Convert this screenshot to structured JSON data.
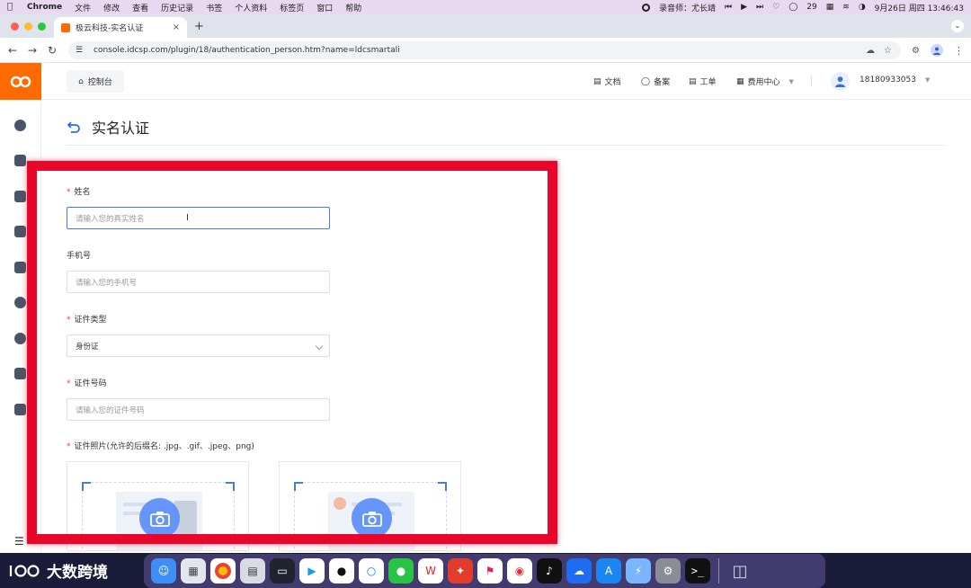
{
  "menubar": {
    "app": "Chrome",
    "items": [
      "文件",
      "修改",
      "查看",
      "历史记录",
      "书签",
      "个人资料",
      "标签页",
      "窗口",
      "帮助"
    ],
    "recorder": "录音师：尤长靖",
    "battery_count": "29",
    "datetime": "9月26日 周四 13:46:43"
  },
  "browser": {
    "tab_title": "极云科技-实名认证",
    "url": "console.idcsp.com/plugin/18/authentication_person.htm?name=ldcsmartali"
  },
  "header": {
    "console_label": "控制台",
    "nav": [
      "文档",
      "备案",
      "工单",
      "费用中心"
    ],
    "username": "18180933053"
  },
  "page": {
    "title": "实名认证"
  },
  "form": {
    "name": {
      "label": "姓名",
      "required": "*",
      "placeholder": "请输入您的真实姓名"
    },
    "phone": {
      "label": "手机号",
      "placeholder": "请输入您的手机号"
    },
    "id_type": {
      "label": "证件类型",
      "required": "*",
      "value": "身份证"
    },
    "id_number": {
      "label": "证件号码",
      "required": "*",
      "placeholder": "请输入您的证件号码"
    },
    "photo": {
      "label": "证件照片(允许的后缀名: .jpg、.gif、.jpeg、png)",
      "required": "*"
    }
  },
  "dock": {
    "brand": "大数跨境"
  },
  "colors": {
    "brand_orange": "#ff6a00",
    "annotation_red": "#e8062a",
    "focus_blue": "#4a7bd8",
    "camera_blue": "#5b8ff9"
  }
}
